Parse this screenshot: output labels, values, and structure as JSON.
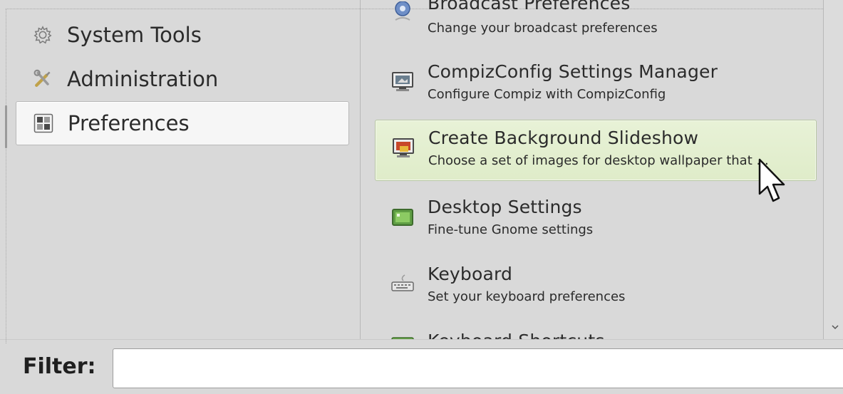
{
  "categories": [
    {
      "label": "System Tools",
      "icon": "gear-icon"
    },
    {
      "label": "Administration",
      "icon": "tools-icon"
    },
    {
      "label": "Preferences",
      "icon": "preferences-icon",
      "selected": true
    }
  ],
  "apps": [
    {
      "name": "Broadcast Preferences",
      "description": "Change your broadcast preferences",
      "icon": "broadcast-icon"
    },
    {
      "name": "CompizConfig Settings Manager",
      "description": "Configure Compiz with CompizConfig",
      "icon": "monitor-icon"
    },
    {
      "name": "Create Background Slideshow",
      "description": "Choose a set of images for desktop wallpaper that ...",
      "icon": "slideshow-icon",
      "selected": true
    },
    {
      "name": "Desktop Settings",
      "description": "Fine-tune Gnome settings",
      "icon": "desktop-settings-icon"
    },
    {
      "name": "Keyboard",
      "description": "Set your keyboard preferences",
      "icon": "keyboard-icon"
    },
    {
      "name": "Keyboard Shortcuts",
      "description": "",
      "icon": "keyboard-shortcuts-icon"
    }
  ],
  "filter": {
    "label": "Filter:",
    "value": "",
    "placeholder": ""
  },
  "colors": {
    "selected_app_bg": "#e2eed0",
    "selected_app_border": "#b7c7a2",
    "window_bg": "#d9d9d9"
  }
}
